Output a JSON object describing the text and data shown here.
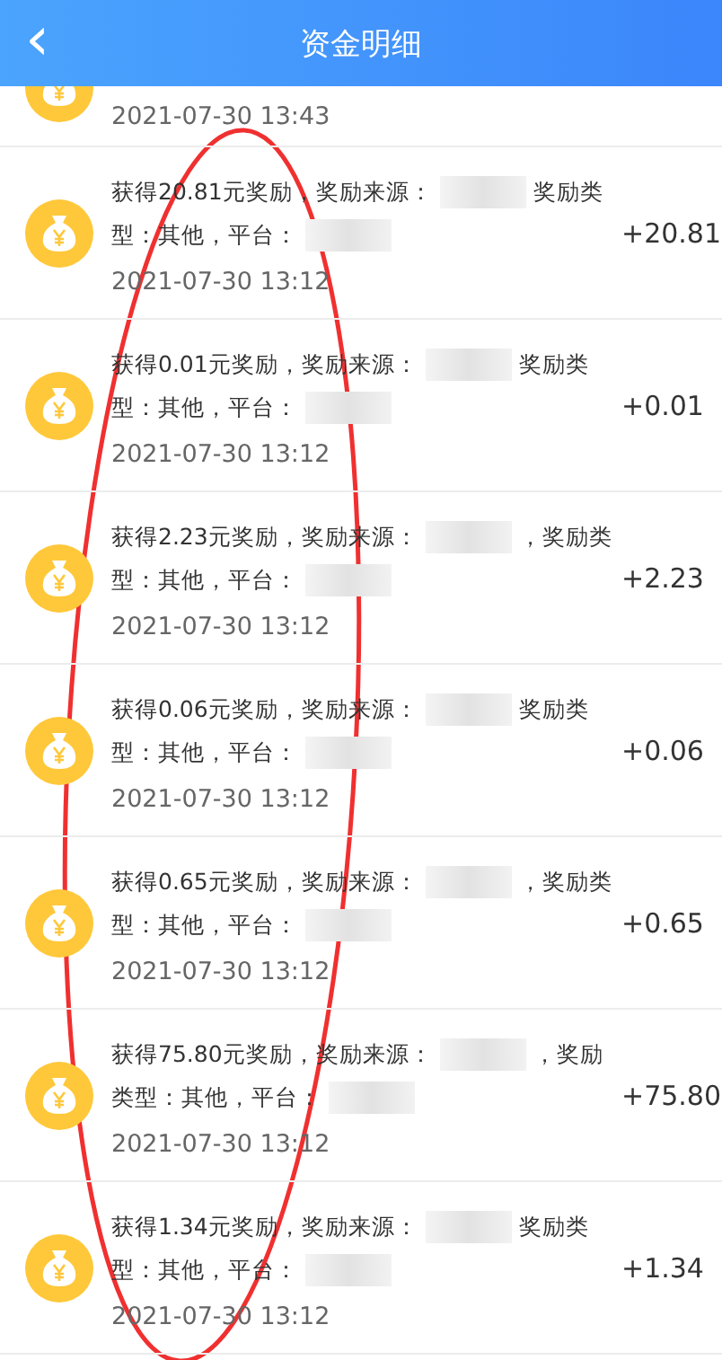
{
  "header": {
    "back_icon": "‹",
    "title": "资金明细"
  },
  "partial_row": {
    "time": "2021-07-30 13:43"
  },
  "records": [
    {
      "parts": [
        "获得20.81元奖励，奖励来源：",
        "奖励类型：其他，平台："
      ],
      "time": "2021-07-30 13:12",
      "amount": "+20.81"
    },
    {
      "parts": [
        "获得0.01元奖励，奖励来源：",
        "奖励类型：其他，平台："
      ],
      "time": "2021-07-30 13:12",
      "amount": "+0.01"
    },
    {
      "parts": [
        "获得2.23元奖励，奖励来源：",
        "，奖励类型：其他，平台："
      ],
      "time": "2021-07-30 13:12",
      "amount": "+2.23"
    },
    {
      "parts": [
        "获得0.06元奖励，奖励来源：",
        "奖励类型：其他，平台："
      ],
      "time": "2021-07-30 13:12",
      "amount": "+0.06"
    },
    {
      "parts": [
        "获得0.65元奖励，奖励来源：",
        "，奖励类型：其他，平台："
      ],
      "time": "2021-07-30 13:12",
      "amount": "+0.65"
    },
    {
      "parts": [
        "获得75.80元奖励，奖励来源：",
        "，奖励类型：其他，平台："
      ],
      "time": "2021-07-30 13:12",
      "amount": "+75.80"
    },
    {
      "parts": [
        "获得1.34元奖励，奖励来源：",
        "奖励类型：其他，平台："
      ],
      "time": "2021-07-30 13:12",
      "amount": "+1.34"
    }
  ],
  "annotation": {
    "kind": "ellipse"
  }
}
